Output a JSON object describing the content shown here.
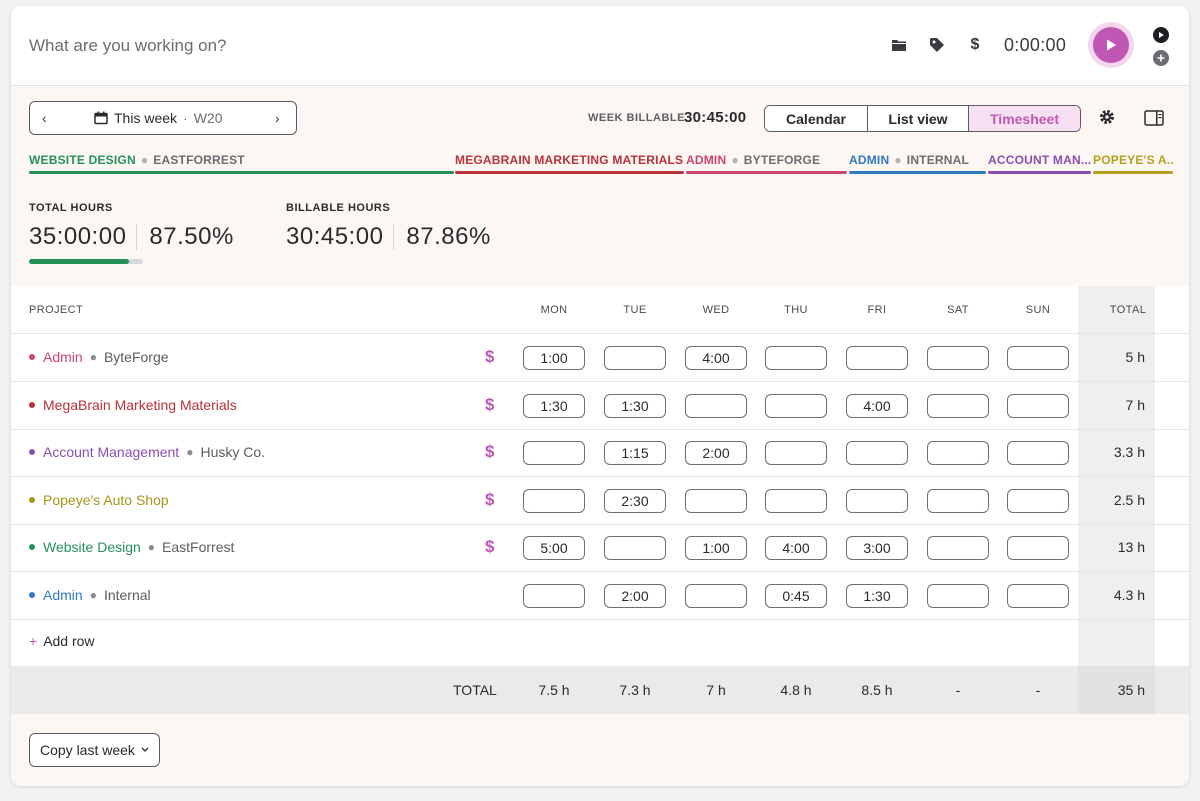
{
  "timer_bar": {
    "placeholder": "What are you working on?",
    "timer": "0:00:00",
    "icons": [
      "folder-icon",
      "tag-icon",
      "dollar-icon",
      "play-icon",
      "small-play-icon",
      "small-add-icon"
    ]
  },
  "week_picker": {
    "label": "This week",
    "week": "W20"
  },
  "week_billable": {
    "label": "WEEK BILLABLE",
    "value": "30:45:00"
  },
  "views": {
    "calendar": "Calendar",
    "list": "List view",
    "timesheet": "Timesheet",
    "active": "Timesheet"
  },
  "project_legend": [
    {
      "project": "WEBSITE DESIGN",
      "client": "EASTFORREST",
      "color": "#25915a"
    },
    {
      "project": "MEGABRAIN MARKETING MATERIALS",
      "client": "",
      "color": "#b8323a"
    },
    {
      "project": "ADMIN",
      "client": "BYTEFORGE",
      "color": "#cc4470"
    },
    {
      "project": "ADMIN",
      "client": "INTERNAL",
      "color": "#2f79c0"
    },
    {
      "project": "ACCOUNT MAN...",
      "client": "",
      "color": "#8a4fb5"
    },
    {
      "project": "POPEYE'S A...",
      "client": "",
      "color": "#b5a020"
    }
  ],
  "stats": {
    "total_label": "TOTAL HOURS",
    "total_hours": "35:00:00",
    "total_pct": "87.50%",
    "total_progress": 0.875,
    "billable_label": "BILLABLE HOURS",
    "billable_hours": "30:45:00",
    "billable_pct": "87.86%"
  },
  "table": {
    "headers": {
      "project": "PROJECT",
      "days": [
        "MON",
        "TUE",
        "WED",
        "THU",
        "FRI",
        "SAT",
        "SUN"
      ],
      "total": "TOTAL"
    },
    "rows": [
      {
        "project": "Admin",
        "client": "ByteForge",
        "color": "#cc4470",
        "billable": true,
        "billable_symbol": "$",
        "cells": [
          "1:00",
          "",
          "4:00",
          "",
          "",
          "",
          ""
        ],
        "total": "5 h"
      },
      {
        "project": "MegaBrain Marketing Materials",
        "client": "",
        "color": "#b8323a",
        "billable": true,
        "billable_symbol": "$",
        "cells": [
          "1:30",
          "1:30",
          "",
          "",
          "4:00",
          "",
          ""
        ],
        "total": "7 h"
      },
      {
        "project": "Account Management",
        "client": "Husky Co.",
        "color": "#8a4fb5",
        "billable": true,
        "billable_symbol": "$",
        "cells": [
          "",
          "1:15",
          "2:00",
          "",
          "",
          "",
          ""
        ],
        "total": "3.3 h"
      },
      {
        "project": "Popeye's Auto Shop",
        "client": "",
        "color": "#a89418",
        "billable": true,
        "billable_symbol": "$",
        "cells": [
          "",
          "2:30",
          "",
          "",
          "",
          "",
          ""
        ],
        "total": "2.5 h"
      },
      {
        "project": "Website Design",
        "client": "EastForrest",
        "color": "#25915a",
        "billable": true,
        "billable_symbol": "$",
        "cells": [
          "5:00",
          "",
          "1:00",
          "4:00",
          "3:00",
          "",
          ""
        ],
        "total": "13 h"
      },
      {
        "project": "Admin",
        "client": "Internal",
        "color": "#2f79c0",
        "billable": false,
        "billable_symbol": "",
        "cells": [
          "",
          "2:00",
          "",
          "0:45",
          "1:30",
          "",
          ""
        ],
        "total": "4.3 h"
      }
    ],
    "add_row": "Add row",
    "totals_label": "TOTAL",
    "totals": [
      "7.5 h",
      "7.3 h",
      "7 h",
      "4.8 h",
      "8.5 h",
      "-",
      "-"
    ],
    "grand_total": "35 h"
  },
  "footer": {
    "copy_label": "Copy last week"
  }
}
